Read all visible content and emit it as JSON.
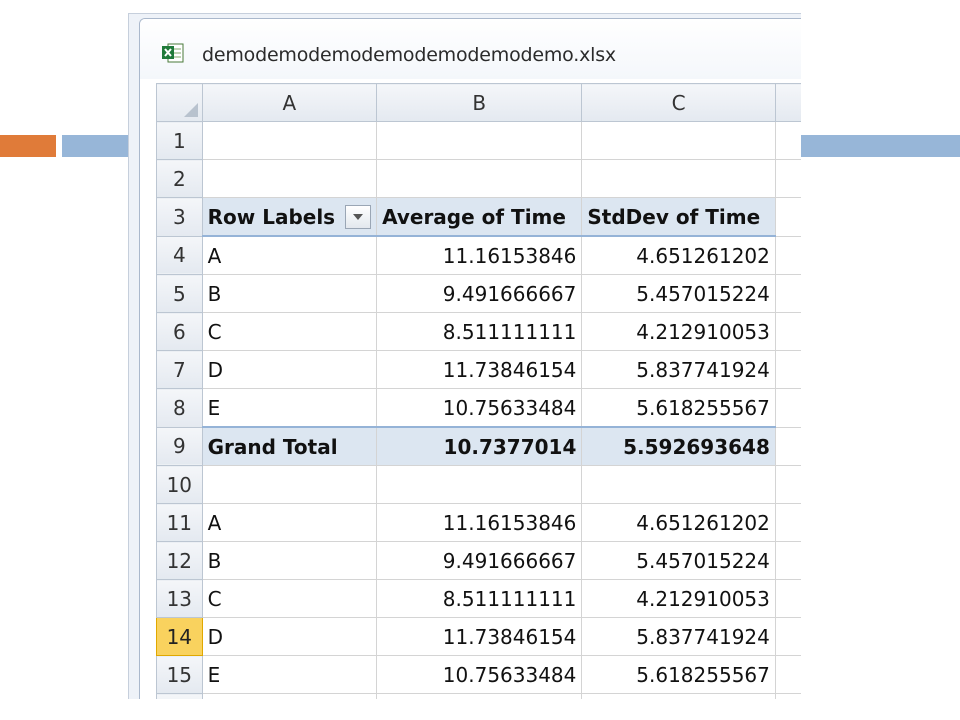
{
  "window": {
    "title": "demodemodemodemodemodemodemo.xlsx"
  },
  "columns": [
    "A",
    "B",
    "C"
  ],
  "pivot_header": {
    "row_labels": "Row Labels",
    "avg_label": "Average of Time",
    "std_label": "StdDev of Time"
  },
  "rows": [
    {
      "num": "1",
      "a": "",
      "b": "",
      "c": ""
    },
    {
      "num": "2",
      "a": "",
      "b": "",
      "c": ""
    },
    {
      "num": "3"
    },
    {
      "num": "4",
      "a": "A",
      "b": "11.16153846",
      "c": "4.651261202"
    },
    {
      "num": "5",
      "a": "B",
      "b": "9.491666667",
      "c": "5.457015224"
    },
    {
      "num": "6",
      "a": "C",
      "b": "8.511111111",
      "c": "4.212910053"
    },
    {
      "num": "7",
      "a": "D",
      "b": "11.73846154",
      "c": "5.837741924"
    },
    {
      "num": "8",
      "a": "E",
      "b": "10.75633484",
      "c": "5.618255567"
    },
    {
      "num": "9",
      "a": "Grand Total",
      "b": "10.7377014",
      "c": "5.592693648"
    },
    {
      "num": "10",
      "a": "",
      "b": "",
      "c": ""
    },
    {
      "num": "11",
      "a": "A",
      "b": "11.16153846",
      "c": "4.651261202"
    },
    {
      "num": "12",
      "a": "B",
      "b": "9.491666667",
      "c": "5.457015224"
    },
    {
      "num": "13",
      "a": "C",
      "b": "8.511111111",
      "c": "4.212910053"
    },
    {
      "num": "14",
      "a": "D",
      "b": "11.73846154",
      "c": "5.837741924"
    },
    {
      "num": "15",
      "a": "E",
      "b": "10.75633484",
      "c": "5.618255567"
    }
  ],
  "selected_row": "14",
  "colors": {
    "accent_orange": "#e07b39",
    "accent_blue": "#97b6d8",
    "pivot_header_fill": "#dce6f1",
    "selected_row_header": "#f9d25e"
  },
  "icons": {
    "app": "excel-icon",
    "filter": "dropdown-arrow-icon"
  }
}
